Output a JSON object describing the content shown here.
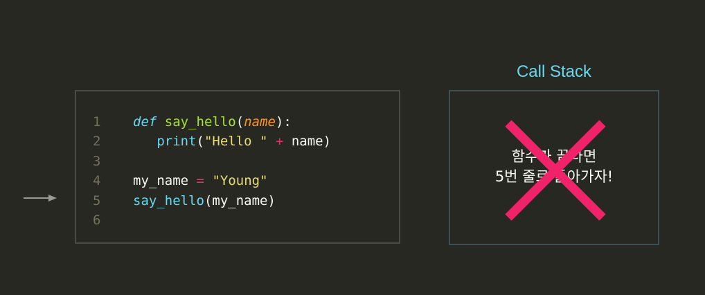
{
  "code": {
    "line_numbers": [
      "1",
      "2",
      "3",
      "4",
      "5",
      "6"
    ],
    "line1": {
      "kw": "def",
      "fn": "say_hello",
      "open": "(",
      "param": "name",
      "close": "):"
    },
    "line2": {
      "builtin": "print",
      "open": "(",
      "str": "\"Hello \"",
      "op": "+",
      "ident": "name",
      "close": ")"
    },
    "line4": {
      "ident": "my_name",
      "op": "=",
      "str": "\"Young\""
    },
    "line5": {
      "fn": "say_hello",
      "open": "(",
      "ident": "my_name",
      "close": ")"
    }
  },
  "call_stack": {
    "title": "Call Stack",
    "note_line1": "함수가 끝나면",
    "note_line2": "5번 줄로 돌아가자!"
  },
  "colors": {
    "background": "#272822",
    "accent": "#66d9ef",
    "cross": "#f0226a"
  }
}
